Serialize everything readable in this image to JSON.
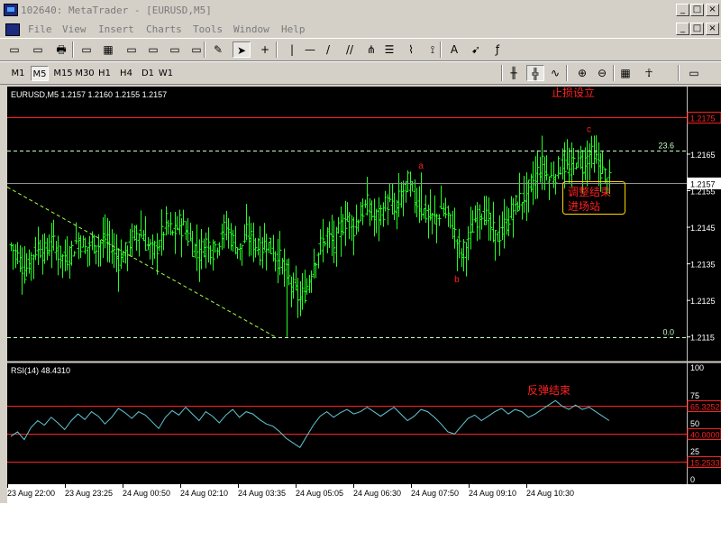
{
  "window": {
    "title": "102640: MetaTrader - [EURUSD,M5]",
    "controls": [
      "_",
      "□",
      "×"
    ],
    "child_controls": [
      "_",
      "□",
      "×"
    ]
  },
  "menu": {
    "items": [
      "File",
      "View",
      "Insert",
      "Charts",
      "Tools",
      "Window",
      "Help"
    ]
  },
  "toolbar1": {
    "icons": [
      "new-chart-icon",
      "open-icon",
      "print-icon",
      "print-preview-icon",
      "market-watch-icon",
      "data-window-icon",
      "navigator-icon",
      "terminal-icon",
      "properties-icon",
      "expert-advisors-icon",
      "cursor-icon",
      "crosshair-icon",
      "vertical-line-icon",
      "horizontal-line-icon",
      "trendline-icon",
      "equidistant-channel-icon",
      "andrews-pitchfork-icon",
      "fibonacci-icon",
      "gann-fan-icon",
      "fibonacci-fan-icon",
      "text-icon",
      "arrow-icon",
      "cycle-lines-icon"
    ],
    "symbols": [
      "▭",
      "▭",
      "🖶",
      "▭",
      "▦",
      "▭",
      "▭",
      "▭",
      "▭",
      "✎",
      "➤",
      "+",
      "|",
      "—",
      "/",
      "//",
      "⋔",
      "☰",
      "⌇",
      "⟟",
      "A",
      "➹",
      "ƒ"
    ]
  },
  "toolbar2": {
    "timeframes": [
      "M1",
      "M5",
      "M15",
      "M30",
      "H1",
      "H4",
      "D1",
      "W1"
    ],
    "active_timeframe": "M5",
    "right_icons": [
      "bar-chart-icon",
      "candlestick-icon",
      "line-chart-icon",
      "zoom-in-icon",
      "zoom-out-icon",
      "tile-windows-icon",
      "expert-icon",
      "periods-icon"
    ],
    "right_symbols": [
      "╫",
      "╬",
      "∿",
      "⊕",
      "⊖",
      "▦",
      "☥",
      "▭"
    ]
  },
  "chart_data": [
    {
      "type": "bar",
      "title": "EURUSD,M5  1.2157 1.2160 1.2155 1.2157",
      "symbol": "EURUSD,M5",
      "ohlc_readout": "1.2157 1.2160 1.2155 1.2157",
      "ylim": [
        1.211,
        1.2182
      ],
      "y_ticks": [
        "1.2165",
        "1.2155",
        "1.2145",
        "1.2135",
        "1.2125",
        "1.2115"
      ],
      "y_tick_values": [
        1.2165,
        1.2155,
        1.2145,
        1.2135,
        1.2125,
        1.2115
      ],
      "price_labels": [
        {
          "value": 1.2175,
          "text": "1.2175",
          "color": "#ff2020"
        },
        {
          "value": 1.2157,
          "text": "1.2157",
          "color": "#ffffff"
        }
      ],
      "close_series": [
        [
          0,
          1.214
        ],
        [
          3,
          1.2137
        ],
        [
          6,
          1.2133
        ],
        [
          9,
          1.2137
        ],
        [
          12,
          1.214
        ],
        [
          15,
          1.2138
        ],
        [
          18,
          1.2141
        ],
        [
          21,
          1.2138
        ],
        [
          24,
          1.2136
        ],
        [
          27,
          1.2139
        ],
        [
          30,
          1.2142
        ],
        [
          33,
          1.2139
        ],
        [
          36,
          1.2141
        ],
        [
          39,
          1.214
        ],
        [
          42,
          1.2142
        ],
        [
          45,
          1.2139
        ],
        [
          48,
          1.2136
        ],
        [
          51,
          1.2138
        ],
        [
          54,
          1.2142
        ],
        [
          57,
          1.2144
        ],
        [
          60,
          1.2141
        ],
        [
          63,
          1.2138
        ],
        [
          66,
          1.2141
        ],
        [
          69,
          1.2146
        ],
        [
          72,
          1.2143
        ],
        [
          75,
          1.2146
        ],
        [
          78,
          1.2144
        ],
        [
          81,
          1.214
        ],
        [
          84,
          1.2138
        ],
        [
          87,
          1.2141
        ],
        [
          90,
          1.2139
        ],
        [
          93,
          1.2142
        ],
        [
          96,
          1.2145
        ],
        [
          99,
          1.2141
        ],
        [
          102,
          1.2139
        ],
        [
          105,
          1.2143
        ],
        [
          108,
          1.2141
        ],
        [
          111,
          1.2139
        ],
        [
          114,
          1.2141
        ],
        [
          117,
          1.2138
        ],
        [
          120,
          1.2136
        ],
        [
          123,
          1.2132
        ],
        [
          126,
          1.2128
        ],
        [
          129,
          1.2125
        ],
        [
          132,
          1.2129
        ],
        [
          135,
          1.2136
        ],
        [
          138,
          1.214
        ],
        [
          141,
          1.2143
        ],
        [
          144,
          1.214
        ],
        [
          147,
          1.2145
        ],
        [
          150,
          1.2148
        ],
        [
          153,
          1.2145
        ],
        [
          156,
          1.2149
        ],
        [
          159,
          1.2151
        ],
        [
          162,
          1.2147
        ],
        [
          165,
          1.2149
        ],
        [
          168,
          1.2152
        ],
        [
          171,
          1.2149
        ],
        [
          174,
          1.2154
        ],
        [
          177,
          1.2157
        ],
        [
          180,
          1.2153
        ],
        [
          183,
          1.215
        ],
        [
          186,
          1.2148
        ],
        [
          189,
          1.2147
        ],
        [
          192,
          1.215
        ],
        [
          195,
          1.2148
        ],
        [
          198,
          1.2143
        ],
        [
          201,
          1.2137
        ],
        [
          204,
          1.2142
        ],
        [
          207,
          1.2147
        ],
        [
          210,
          1.215
        ],
        [
          213,
          1.2146
        ],
        [
          216,
          1.2142
        ],
        [
          219,
          1.2144
        ],
        [
          222,
          1.2148
        ],
        [
          225,
          1.2151
        ],
        [
          228,
          1.2153
        ],
        [
          231,
          1.2155
        ],
        [
          234,
          1.2159
        ],
        [
          237,
          1.2162
        ],
        [
          240,
          1.2158
        ],
        [
          243,
          1.216
        ],
        [
          246,
          1.2163
        ],
        [
          249,
          1.216
        ],
        [
          252,
          1.2164
        ],
        [
          255,
          1.2162
        ],
        [
          258,
          1.2165
        ],
        [
          261,
          1.2163
        ],
        [
          264,
          1.216
        ],
        [
          267,
          1.2157
        ]
      ],
      "extreme_bars": [
        {
          "idx": 123,
          "low": 1.2115
        },
        {
          "idx": 199,
          "low": 1.2133
        },
        {
          "idx": 183,
          "high": 1.216
        },
        {
          "idx": 258,
          "high": 1.2168
        }
      ],
      "levels": [
        {
          "name": "stop-loss",
          "value": 1.2175,
          "style": "solid",
          "color": "#ff2020"
        },
        {
          "name": "fib-23.6",
          "value": 1.2166,
          "style": "dashed",
          "color": "#c8ffc8",
          "label": "23.6"
        },
        {
          "name": "bid",
          "value": 1.2157,
          "style": "solid",
          "color": "#909090"
        },
        {
          "name": "fib-0.0",
          "value": 1.2115,
          "style": "dashed",
          "color": "#c8ffc8",
          "label": "0.0"
        }
      ],
      "trendline": {
        "from": {
          "idx": 0,
          "value": 1.2156
        },
        "to": {
          "idx": 118,
          "value": 1.2115
        },
        "color": "#a6ff4a"
      },
      "wave_labels": [
        {
          "text": "a",
          "idx": 183,
          "value": 1.2161
        },
        {
          "text": "b",
          "idx": 199,
          "value": 1.213
        },
        {
          "text": "c",
          "idx": 258,
          "value": 1.2171
        }
      ],
      "annotations": {
        "stop_loss": "止损设立",
        "entry_line1": "调整结束",
        "entry_line2": "进场站"
      },
      "colors": {
        "bars": "#22ff22",
        "annotation": "#ff2020",
        "box_border": "#ffd700"
      }
    },
    {
      "type": "line",
      "title": "RSI(14) 48.4310",
      "name": "RSI(14)",
      "value_readout": "48.4310",
      "ylim": [
        0,
        100
      ],
      "y_ticks": [
        "100",
        "75",
        "50",
        "25",
        "0"
      ],
      "y_tick_values": [
        100,
        75,
        50,
        25,
        0
      ],
      "levels": [
        {
          "value": 65.3252,
          "label": "65.3252",
          "color": "#ff2020"
        },
        {
          "value": 40.0,
          "label": "40.0000",
          "color": "#ff2020"
        },
        {
          "value": 15.2533,
          "label": "15.2533",
          "color": "#ff2020"
        }
      ],
      "series": [
        {
          "values": [
            38,
            42,
            35,
            46,
            52,
            48,
            55,
            50,
            44,
            52,
            58,
            53,
            60,
            56,
            49,
            55,
            63,
            59,
            54,
            60,
            57,
            51,
            45,
            55,
            61,
            57,
            64,
            58,
            52,
            60,
            56,
            50,
            57,
            62,
            55,
            60,
            58,
            53,
            49,
            47,
            42,
            36,
            32,
            28,
            38,
            48,
            56,
            60,
            55,
            59,
            62,
            58,
            60,
            64,
            60,
            56,
            60,
            64,
            58,
            52,
            56,
            62,
            60,
            55,
            49,
            42,
            40,
            47,
            54,
            57,
            52,
            56,
            60,
            63,
            58,
            62,
            60,
            55,
            58,
            62,
            66,
            70,
            65,
            62,
            66,
            62,
            64,
            60,
            56,
            52
          ]
        }
      ],
      "line_color": "#5fc8d8",
      "annotation": "反弹结束",
      "annotation_idx": 228
    }
  ],
  "x_axis": {
    "labels": [
      "23 Aug 22:00",
      "23 Aug 23:25",
      "24 Aug 00:50",
      "24 Aug 02:10",
      "24 Aug 03:35",
      "24 Aug 05:05",
      "24 Aug 06:30",
      "24 Aug 07:50",
      "24 Aug 09:10",
      "24 Aug 10:30"
    ]
  }
}
